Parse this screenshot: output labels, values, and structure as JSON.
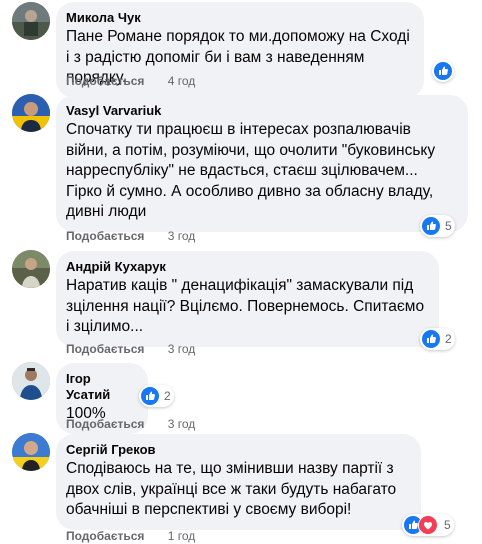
{
  "comments": [
    {
      "author": "Микола Чук",
      "text": "Пане Романе порядок то ми.допоможу на Сході і з радістю допоміг би і вам з наведенням порядку.",
      "like_label": "Подобається",
      "time": "4 год",
      "reactions": {
        "types": [
          "like"
        ],
        "count": ""
      }
    },
    {
      "author": "Vasyl Varvariuk",
      "text": "Спочатку ти працюєш в інтересах розпалювачів війни, а потім, розуміючи, що очолити \"буковинську нарреспубліку\" не вдасться, стаєш зцілювачем... Гірко й сумно. А особливо дивно за обласну владу, дивні люди",
      "like_label": "Подобається",
      "time": "3 год",
      "reactions": {
        "types": [
          "like"
        ],
        "count": "5"
      }
    },
    {
      "author": "Андрій Кухарук",
      "text": "Наратив каців \" денацифікація\" замаскували під зцілення нації? Вцілємо. Повернемось. Спитаємо і зцілимо...",
      "like_label": "Подобається",
      "time": "3 год",
      "reactions": {
        "types": [
          "like"
        ],
        "count": "2"
      }
    },
    {
      "author": "Ігор Усатий",
      "text": "100%",
      "like_label": "Подобається",
      "time": "3 год",
      "reactions": {
        "types": [
          "like"
        ],
        "count": "2"
      }
    },
    {
      "author": "Сергій Греков",
      "text": "Сподіваюсь на те, що змінивши назву партії з двох слів, українці все ж таки будуть набагато обачніші в перспективі у своєму виборі!",
      "like_label": "Подобається",
      "time": "1 год",
      "reactions": {
        "types": [
          "like",
          "love"
        ],
        "count": "5"
      }
    }
  ],
  "colors": {
    "like_blue": "#1877f2",
    "love_red": "#f33e58",
    "bubble_bg": "#f0f2f5",
    "meta_gray": "#65676b"
  }
}
